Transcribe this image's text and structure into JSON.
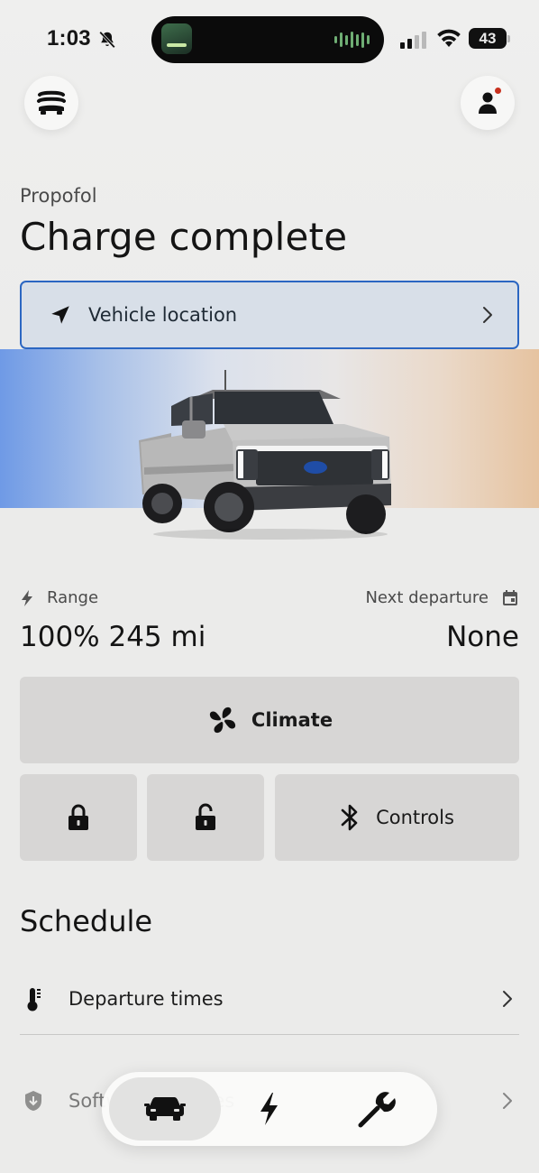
{
  "status_bar": {
    "time": "1:03",
    "battery": "43",
    "icons": [
      "bell-slash-icon",
      "app-icon",
      "signal-icon",
      "wifi-icon",
      "battery-icon"
    ]
  },
  "header": {
    "vehicle_name": "Propofol",
    "status_title": "Charge complete"
  },
  "location": {
    "label": "Vehicle location",
    "icon": "navigation-arrow-icon"
  },
  "info": {
    "range_label": "Range",
    "range_value": "100% 245 mi",
    "next_departure_label": "Next departure",
    "next_departure_value": "None"
  },
  "controls": {
    "climate_label": "Climate",
    "controls_label": "Controls",
    "icons": [
      "fan-icon",
      "lock-icon",
      "unlock-icon",
      "bluetooth-icon"
    ]
  },
  "schedule": {
    "title": "Schedule",
    "items": [
      {
        "label": "Departure times",
        "icon": "thermometer-icon"
      },
      {
        "label": "Software updates",
        "icon": "shield-download-icon"
      }
    ]
  },
  "tabbar": {
    "tabs": [
      {
        "name": "vehicle",
        "icon": "car-icon",
        "active": true
      },
      {
        "name": "charge",
        "icon": "lightning-icon",
        "active": false
      },
      {
        "name": "service",
        "icon": "wrench-icon",
        "active": false
      }
    ]
  },
  "colors": {
    "accent_border": "#2b66c2",
    "notification": "#c8311e",
    "tile": "#d7d6d5",
    "background": "#ececeb"
  }
}
